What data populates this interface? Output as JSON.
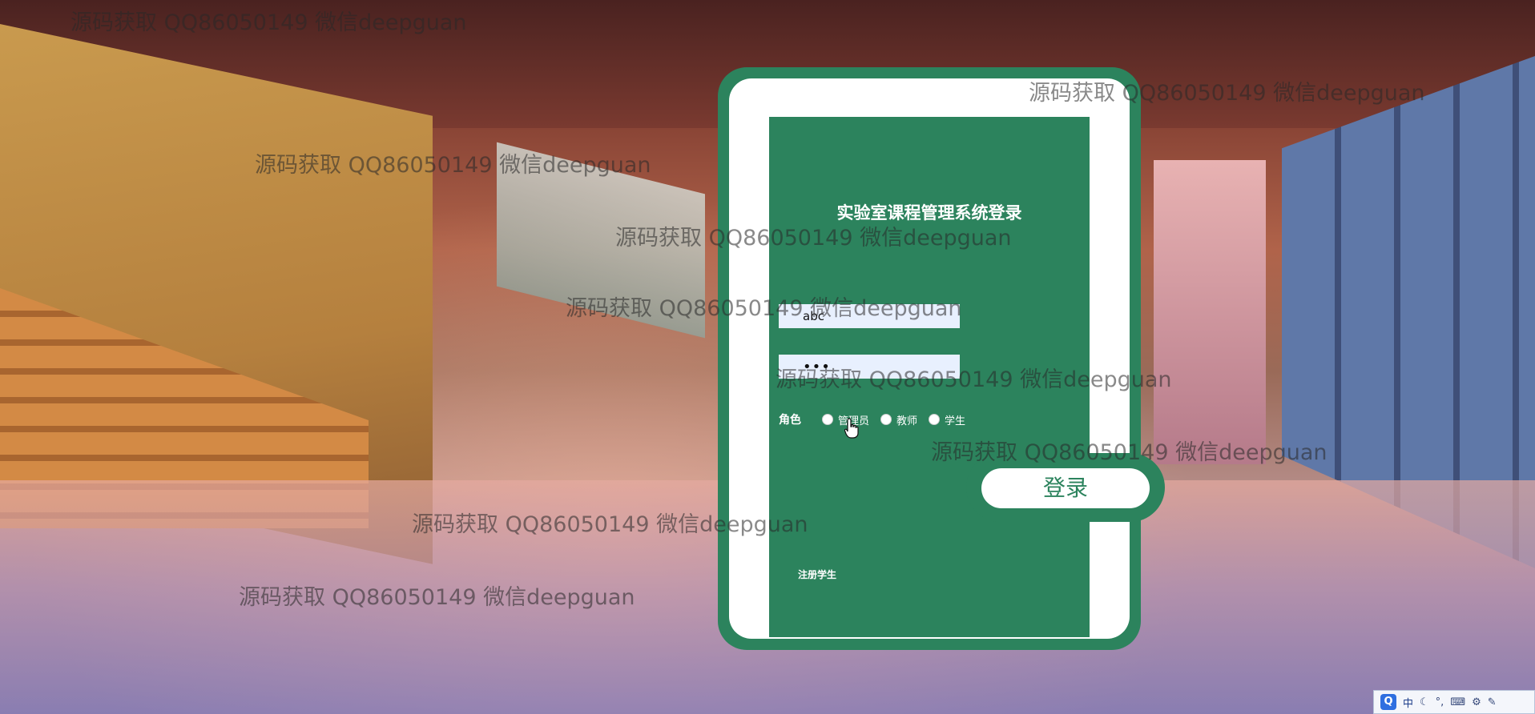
{
  "login": {
    "title": "实验室课程管理系统登录",
    "username_value": "abc",
    "password_value": "•••",
    "role_label": "角色",
    "roles": [
      "管理员",
      "教师",
      "学生"
    ],
    "login_button": "登录",
    "register_link": "注册学生"
  },
  "watermark_text": "源码获取 QQ86050149 微信deepguan",
  "ime": {
    "mode": "中",
    "icons": [
      "moon-icon",
      "punctuation-icon",
      "keyboard-icon",
      "tools-icon",
      "wrench-icon"
    ]
  },
  "colors": {
    "accent": "#2c835d",
    "card": "#ffffff"
  }
}
